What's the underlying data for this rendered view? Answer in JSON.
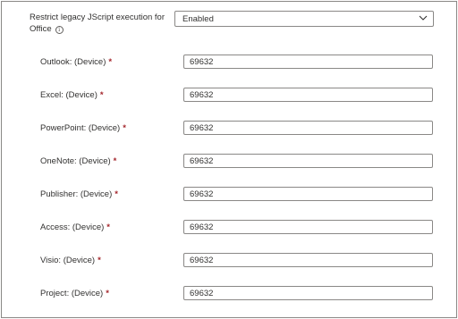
{
  "setting": {
    "label": "Restrict legacy JScript execution for Office",
    "info_icon": "info-icon",
    "value": "Enabled"
  },
  "fields": [
    {
      "label": "Outlook: (Device)",
      "required": "*",
      "value": "69632"
    },
    {
      "label": "Excel: (Device)",
      "required": "*",
      "value": "69632"
    },
    {
      "label": "PowerPoint: (Device)",
      "required": "*",
      "value": "69632"
    },
    {
      "label": "OneNote: (Device)",
      "required": "*",
      "value": "69632"
    },
    {
      "label": "Publisher: (Device)",
      "required": "*",
      "value": "69632"
    },
    {
      "label": "Access: (Device)",
      "required": "*",
      "value": "69632"
    },
    {
      "label": "Visio: (Device)",
      "required": "*",
      "value": "69632"
    },
    {
      "label": "Project: (Device)",
      "required": "*",
      "value": "69632"
    }
  ],
  "colors": {
    "border": "#8a8886",
    "text": "#323130",
    "required": "#a4262c"
  }
}
